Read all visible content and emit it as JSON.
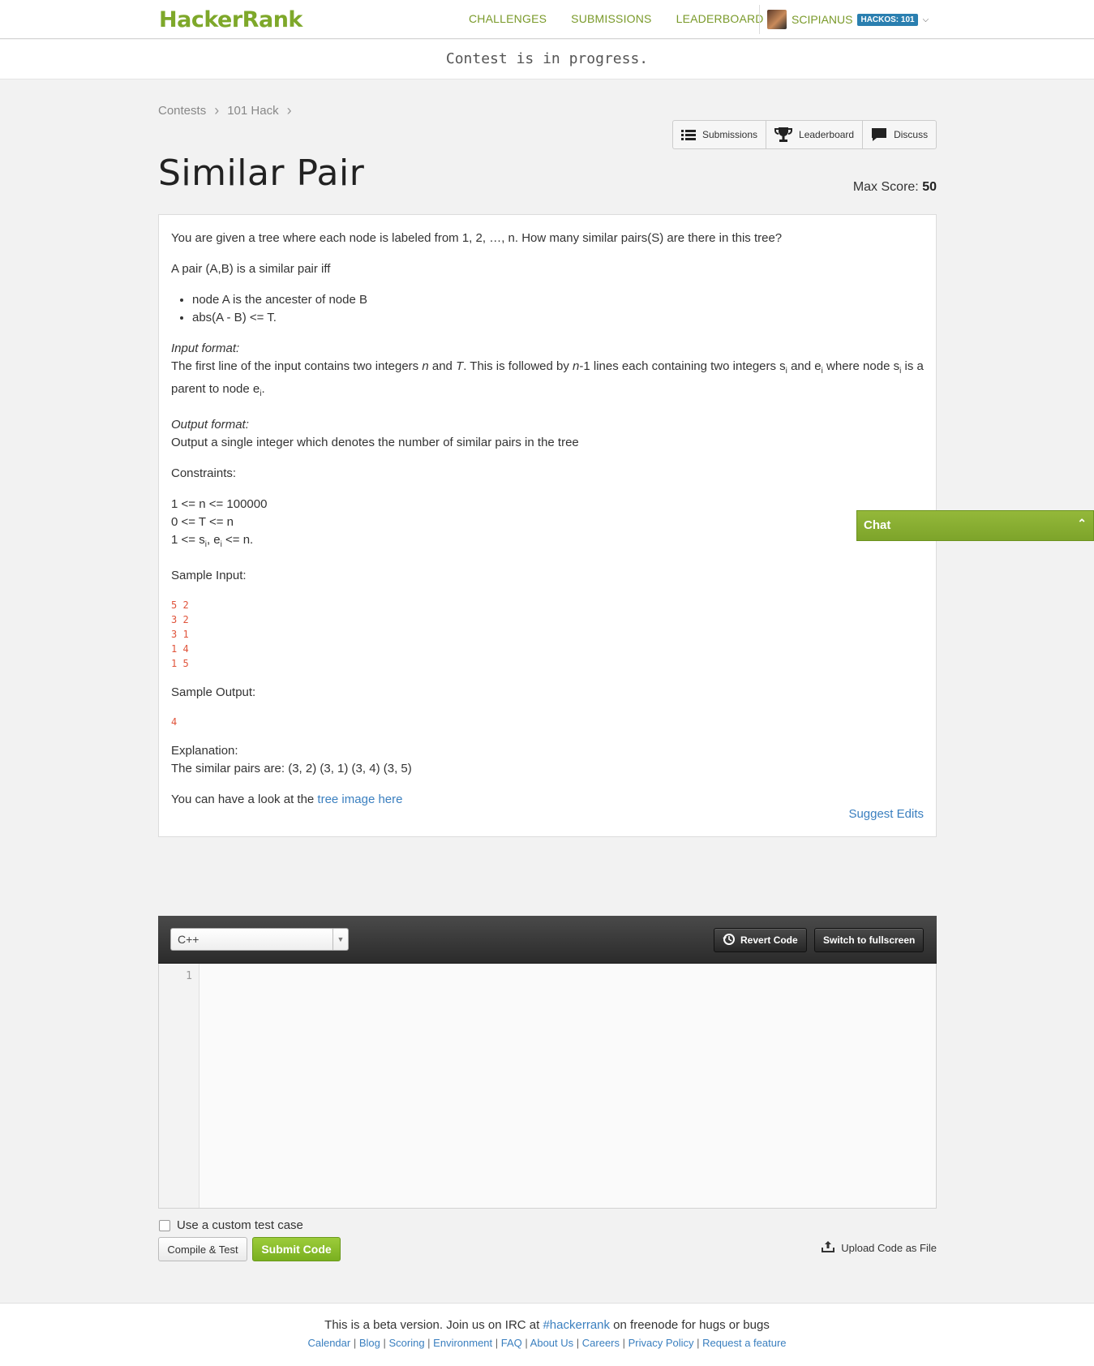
{
  "header": {
    "logo": "HackerRank",
    "nav": [
      "CHALLENGES",
      "SUBMISSIONS",
      "LEADERBOARD"
    ],
    "username": "SCIPIANUS",
    "hackos": "HACKOS: 101"
  },
  "banner": "Contest is in progress.",
  "breadcrumb": [
    "Contests",
    "101 Hack"
  ],
  "actions": {
    "submissions": "Submissions",
    "leaderboard": "Leaderboard",
    "discuss": "Discuss"
  },
  "problem": {
    "title": "Similar Pair",
    "max_score_label": "Max Score:",
    "max_score": "50",
    "intro": "You are given a tree where each node is labeled from 1, 2, …, n. How many similar pairs(S) are there in this tree?",
    "pair_def": "A pair (A,B) is a similar pair iff",
    "conditions": [
      "node A is the ancester of node B",
      "abs(A - B) <= T."
    ],
    "input_label": "Input format:",
    "input_text_1": "The first line of the input contains two integers ",
    "input_text_n": "n",
    "input_text_2": " and ",
    "input_text_T": "T",
    "input_text_3": ". This is followed by ",
    "input_text_n2": "n",
    "input_text_4": "-1 lines each containing two integers s",
    "input_text_5": " and e",
    "input_text_6": " where node s",
    "input_text_7": " is a parent to node e",
    "input_text_8": ".",
    "sub_i": "i",
    "output_label": "Output format:",
    "output_text": "Output a single integer which denotes the number of similar pairs in the tree",
    "constraints_label": "Constraints:",
    "constraint_1": "1 <= n <= 100000",
    "constraint_2": "0 <= T <= n",
    "constraint_3a": "1 <= s",
    "constraint_3b": ", e",
    "constraint_3c": " <= n.",
    "sample_input_label": "Sample Input:",
    "sample_input": [
      "5 2",
      "3 2",
      "3 1",
      "1 4",
      "1 5"
    ],
    "sample_output_label": "Sample Output:",
    "sample_output": "4",
    "explanation_label": "Explanation:",
    "explanation_text": "The similar pairs are: (3, 2) (3, 1) (3, 4) (3, 5)",
    "look_text": "You can have a look at the ",
    "look_link": "tree image here",
    "suggest_edits": "Suggest Edits"
  },
  "chat": {
    "label": "Chat"
  },
  "editor": {
    "language": "C++",
    "revert": "Revert Code",
    "fullscreen": "Switch to fullscreen",
    "line_number": "1"
  },
  "controls": {
    "custom_test": "Use a custom test case",
    "compile": "Compile & Test",
    "submit": "Submit Code",
    "upload": "Upload Code as File"
  },
  "footer": {
    "line_a": "This is a beta version. Join us on IRC at ",
    "irc": "#hackerrank",
    "line_b": " on freenode for hugs or bugs",
    "links": [
      "Calendar",
      "Blog",
      "Scoring",
      "Environment",
      "FAQ",
      "About Us",
      "Careers",
      "Privacy Policy",
      "Request a feature"
    ]
  }
}
